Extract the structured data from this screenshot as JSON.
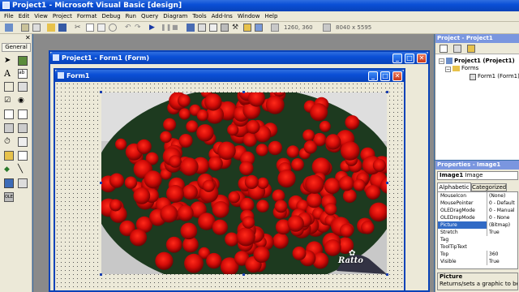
{
  "app": {
    "title": "Project1 - Microsoft Visual Basic [design]"
  },
  "menu": [
    "File",
    "Edit",
    "View",
    "Project",
    "Format",
    "Debug",
    "Run",
    "Query",
    "Diagram",
    "Tools",
    "Add-Ins",
    "Window",
    "Help"
  ],
  "toolbar": {
    "position": "1260, 360",
    "size": "8040 x 5595"
  },
  "toolbox": {
    "tab_label": "General"
  },
  "form_designer": {
    "window_title": "Project1 - Form1 (Form)",
    "form_caption": "Form1",
    "image_logo_text": "Ratto"
  },
  "project_explorer": {
    "title": "Project - Project1",
    "root": "Project1 (Project1)",
    "folder": "Forms",
    "item": "Form1 (Form1)"
  },
  "properties": {
    "title": "Properties - Image1",
    "object_name": "Image1",
    "object_type": "Image",
    "tabs": [
      "Alphabetic",
      "Categorized"
    ],
    "rows": [
      {
        "name": "MouseIcon",
        "value": "(None)"
      },
      {
        "name": "MousePointer",
        "value": "0 - Default"
      },
      {
        "name": "OLEDragMode",
        "value": "0 - Manual"
      },
      {
        "name": "OLEDropMode",
        "value": "0 - None"
      },
      {
        "name": "Picture",
        "value": "(Bitmap)"
      },
      {
        "name": "Stretch",
        "value": "True"
      },
      {
        "name": "Tag",
        "value": ""
      },
      {
        "name": "ToolTipText",
        "value": ""
      },
      {
        "name": "Top",
        "value": "360"
      },
      {
        "name": "Visible",
        "value": "True"
      }
    ],
    "desc_title": "Picture",
    "desc_text": "Returns/sets a graphic to be d"
  }
}
